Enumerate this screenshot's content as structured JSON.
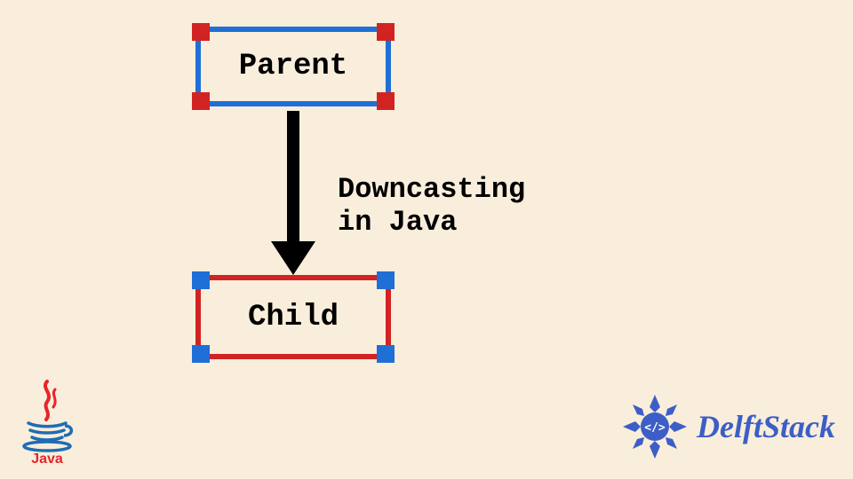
{
  "diagram": {
    "parent_label": "Parent",
    "child_label": "Child",
    "arrow_label": "Downcasting in Java"
  },
  "logos": {
    "java_text": "Java",
    "brand_text": "DelftStack"
  },
  "colors": {
    "bg": "#f9eedb",
    "blue": "#1f6fd6",
    "red": "#d22323",
    "brand_blue": "#3c5ec6",
    "java_red": "#e8242a",
    "java_blue": "#1e6db4"
  }
}
